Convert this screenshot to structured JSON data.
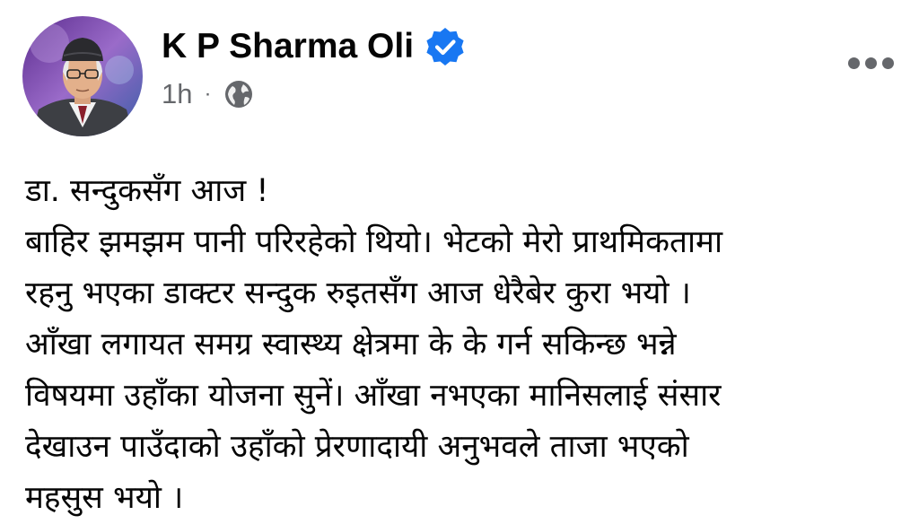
{
  "post": {
    "author": "K P Sharma Oli",
    "time": "1h",
    "separator": "·",
    "lines": [
      "डा. सन्दुकसँग आज !",
      "बाहिर झमझम पानी परिरहेको थियो। भेटको मेरो प्राथमिकतामा",
      "रहनु भएका डाक्टर सन्दुक रुइतसँग आज धेरैबेर कुरा भयो ।",
      "आँखा लगायत समग्र स्वास्थ्य क्षेत्रमा के के गर्न सकिन्छ भन्ने",
      "विषयमा उहाँका योजना सुनें। आँखा नभएका मानिसलाई संसार",
      "देखाउन पाउँदाको उहाँको प्रेरणादायी अनुभवले ताजा भएको",
      "महसुस भयो ।"
    ]
  },
  "icons": {
    "verified": "verified-badge-icon",
    "audience": "globe-icon",
    "menu": "more-options-icon"
  },
  "colors": {
    "verified": "#1877f2",
    "secondary_text": "#65676b",
    "primary_text": "#050505"
  }
}
